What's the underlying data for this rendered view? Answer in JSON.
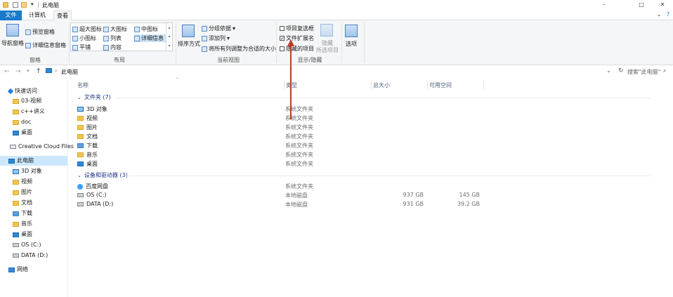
{
  "window": {
    "title": "此电脑",
    "minimize_glyph": "–",
    "maximize_glyph": "□",
    "close_glyph": "✕",
    "help_glyph": "?",
    "expand_glyph": "⌄"
  },
  "tabs": [
    "文件",
    "计算机",
    "查看"
  ],
  "ribbon": {
    "panes": {
      "label": "窗格",
      "nav_pane": "导航窗格",
      "preview_pane": "预览窗格",
      "details_pane": "详细信息窗格"
    },
    "layout": {
      "label": "布局",
      "items": [
        "超大图标",
        "大图标",
        "中图标",
        "小图标",
        "列表",
        "详细信息",
        "平铺",
        "内容"
      ],
      "selected": "详细信息"
    },
    "current_view": {
      "label": "当前视图",
      "sort_by": "排序方式",
      "group_by": "分组依据",
      "add_columns": "添加列",
      "fit_columns": "将所有列调整为合适的大小"
    },
    "show_hide": {
      "label": "显示/隐藏",
      "item_checkboxes": "项目复选框",
      "item_checkboxes_checked": false,
      "file_extensions": "文件扩展名",
      "file_extensions_checked": true,
      "hidden_items": "隐藏的项目",
      "hidden_items_checked": false,
      "hide_selected_1": "隐藏",
      "hide_selected_2": "所选项目"
    },
    "options": "选项"
  },
  "address": {
    "path": "此电脑",
    "search_placeholder": "搜索\"此电脑\""
  },
  "nav": {
    "quick_access": "快速访问",
    "quick_items": [
      "03-视频",
      "c++讲义",
      "doc",
      "桌面"
    ],
    "creative_cloud": "Creative Cloud Files",
    "this_pc": "此电脑",
    "pc_items": [
      "3D 对象",
      "视频",
      "图片",
      "文档",
      "下载",
      "音乐",
      "桌面",
      "OS (C:)",
      "DATA (D:)"
    ],
    "network": "网络"
  },
  "columns": {
    "name": "名称",
    "type": "类型",
    "total_size": "总大小",
    "free_space": "可用空间"
  },
  "groups": {
    "folders_header": "文件夹 (7)",
    "folders": [
      {
        "name": "3D 对象",
        "type": "系统文件夹"
      },
      {
        "name": "视频",
        "type": "系统文件夹"
      },
      {
        "name": "图片",
        "type": "系统文件夹"
      },
      {
        "name": "文档",
        "type": "系统文件夹"
      },
      {
        "name": "下载",
        "type": "系统文件夹"
      },
      {
        "name": "音乐",
        "type": "系统文件夹"
      },
      {
        "name": "桌面",
        "type": "系统文件夹"
      }
    ],
    "devices_header": "设备和驱动器 (3)",
    "devices": [
      {
        "name": "百度网盘",
        "type": "系统文件夹",
        "size": "",
        "free": ""
      },
      {
        "name": "OS (C:)",
        "type": "本地磁盘",
        "size": "937 GB",
        "free": "145 GB"
      },
      {
        "name": "DATA (D:)",
        "type": "本地磁盘",
        "size": "931 GB",
        "free": "39.2 GB"
      }
    ]
  },
  "colors": {
    "accent": "#1979ca",
    "selection": "#cce8ff",
    "annotation_arrow": "#c0392b"
  }
}
